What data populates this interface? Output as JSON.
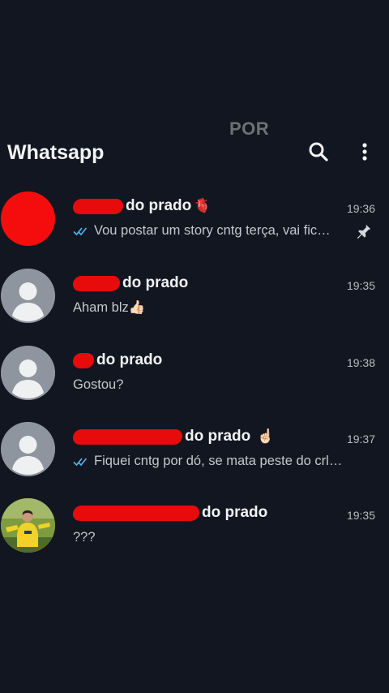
{
  "overlay_text": "POR",
  "header": {
    "title": "Whatsapp",
    "search_icon": "search-icon",
    "menu_icon": "more-vert-icon"
  },
  "chats": [
    {
      "name": "do prado",
      "emoji": "🫀",
      "time": "19:36",
      "preview": "Vou postar um story cntg terça, vai fic…",
      "read_ticks": true,
      "pinned": true,
      "avatar": "red-avatar"
    },
    {
      "name": "do prado",
      "time": "19:35",
      "preview": "Aham blz👍🏻",
      "read_ticks": false,
      "avatar": "default-avatar"
    },
    {
      "name": "do prado",
      "time": "19:38",
      "preview": "Gostou?",
      "read_ticks": false,
      "avatar": "default-avatar"
    },
    {
      "name": "do prado",
      "emoji": "☝🏻",
      "time": "19:37",
      "preview": "Fiquei cntg por dó, se mata peste do crlh …",
      "read_ticks": true,
      "avatar": "default-avatar"
    },
    {
      "name": "do prado",
      "time": "19:35",
      "preview": "???",
      "read_ticks": false,
      "avatar": "photo-avatar"
    }
  ],
  "colors": {
    "background": "#121620",
    "tick_blue": "#4fb7ec",
    "redaction": "#e70b0b"
  }
}
